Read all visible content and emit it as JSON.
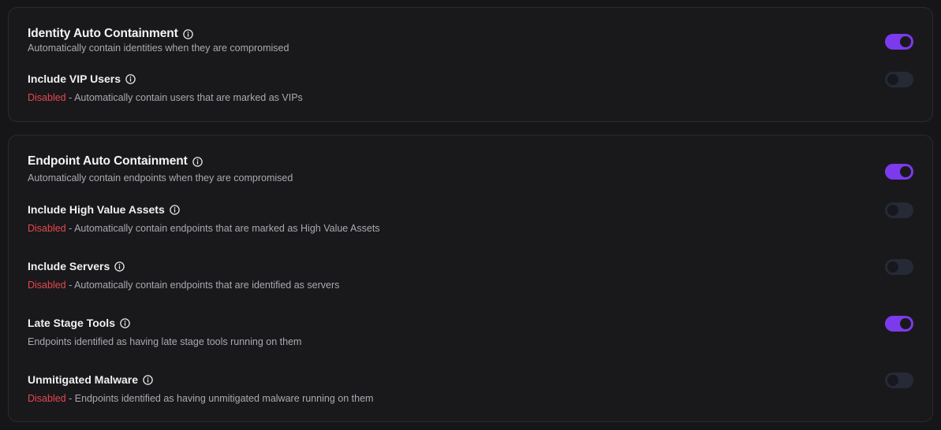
{
  "identity": {
    "title": "Identity Auto Containment",
    "description": "Automatically contain identities when they are compromised",
    "enabled": true,
    "items": [
      {
        "label": "Include VIP Users",
        "status": "Disabled",
        "separator": " - ",
        "description": "Automatically contain users that are marked as VIPs",
        "enabled": false
      }
    ]
  },
  "endpoint": {
    "title": "Endpoint Auto Containment",
    "description": "Automatically contain endpoints when they are compromised",
    "enabled": true,
    "items": [
      {
        "label": "Include High Value Assets",
        "status": "Disabled",
        "separator": " - ",
        "description": "Automatically contain endpoints that are marked as High Value Assets",
        "enabled": false
      },
      {
        "label": "Include Servers",
        "status": "Disabled",
        "separator": " - ",
        "description": "Automatically contain endpoints that are identified as servers",
        "enabled": false
      },
      {
        "label": "Late Stage Tools",
        "status": "",
        "separator": "",
        "description": "Endpoints identified as having late stage tools running on them",
        "enabled": true
      },
      {
        "label": "Unmitigated Malware",
        "status": "Disabled",
        "separator": " - ",
        "description": "Endpoints identified as having unmitigated malware running on them",
        "enabled": false
      }
    ]
  },
  "colors": {
    "toggle_on": "#7c3aed",
    "toggle_off": "#252a36",
    "disabled_text": "#e5484d",
    "background": "#161618"
  },
  "icons": {
    "info": "info-circle-icon"
  }
}
